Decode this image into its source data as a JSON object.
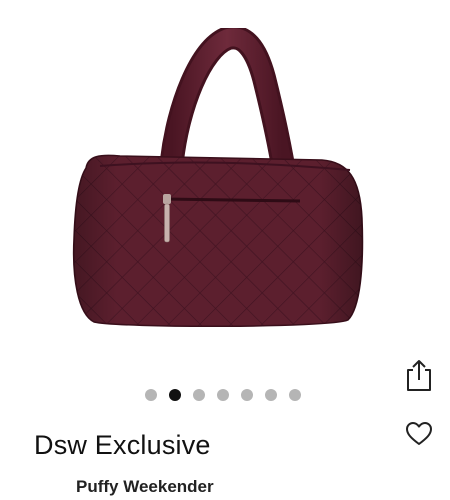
{
  "product": {
    "brand": "Dsw Exclusive",
    "name": "Puffy Weekender",
    "color_hex": "#5a1e2c"
  },
  "carousel": {
    "total_images": 7,
    "active_index": 1
  },
  "actions": {
    "share_icon": "share-icon",
    "favorite_icon": "heart-icon"
  }
}
